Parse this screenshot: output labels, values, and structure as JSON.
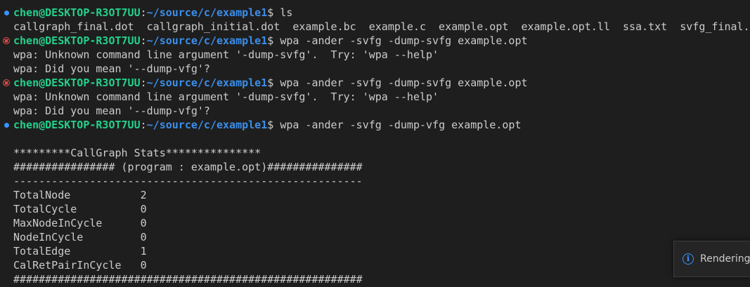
{
  "prompt": {
    "user_host": "chen@DESKTOP-R3OT7UU",
    "separator": ":",
    "path": "~/source/c/example1",
    "symbol": "$ "
  },
  "colors": {
    "background": "#1e1e1e",
    "text": "#cccccc",
    "prompt_user": "#23d18b",
    "prompt_path": "#3b8eea",
    "status_ok": "#3794ff",
    "status_error": "#f14c4c"
  },
  "terminal": {
    "lines": [
      {
        "kind": "prompt",
        "status": "ok",
        "command": "ls"
      },
      {
        "kind": "output",
        "text": "callgraph_final.dot  callgraph_initial.dot  example.bc  example.c  example.opt  example.opt.ll  ssa.txt  svfg_final.dot"
      },
      {
        "kind": "prompt",
        "status": "error",
        "command": "wpa -ander -svfg -dump-svfg example.opt"
      },
      {
        "kind": "output",
        "text": "wpa: Unknown command line argument '-dump-svfg'.  Try: 'wpa --help'"
      },
      {
        "kind": "output",
        "text": "wpa: Did you mean '--dump-vfg'?"
      },
      {
        "kind": "prompt",
        "status": "error",
        "command": "wpa -ander -svfg -dump-svfg example.opt"
      },
      {
        "kind": "output",
        "text": "wpa: Unknown command line argument '-dump-svfg'.  Try: 'wpa --help'"
      },
      {
        "kind": "output",
        "text": "wpa: Did you mean '--dump-vfg'?"
      },
      {
        "kind": "prompt",
        "status": "ok",
        "command": "wpa -ander -svfg -dump-vfg example.opt"
      },
      {
        "kind": "output",
        "text": ""
      },
      {
        "kind": "output",
        "text": "*********CallGraph Stats***************"
      },
      {
        "kind": "output",
        "text": "################ (program : example.opt)###############"
      },
      {
        "kind": "output",
        "text": "-------------------------------------------------------"
      },
      {
        "kind": "output",
        "text": "TotalNode           2"
      },
      {
        "kind": "output",
        "text": "TotalCycle          0"
      },
      {
        "kind": "output",
        "text": "MaxNodeInCycle      0"
      },
      {
        "kind": "output",
        "text": "NodeInCycle         0"
      },
      {
        "kind": "output",
        "text": "TotalEdge           1"
      },
      {
        "kind": "output",
        "text": "CalRetPairInCycle   0"
      },
      {
        "kind": "output",
        "text": "#######################################################"
      }
    ]
  },
  "notification": {
    "icon": "info-icon",
    "icon_glyph": "i",
    "text": "Rendering"
  }
}
